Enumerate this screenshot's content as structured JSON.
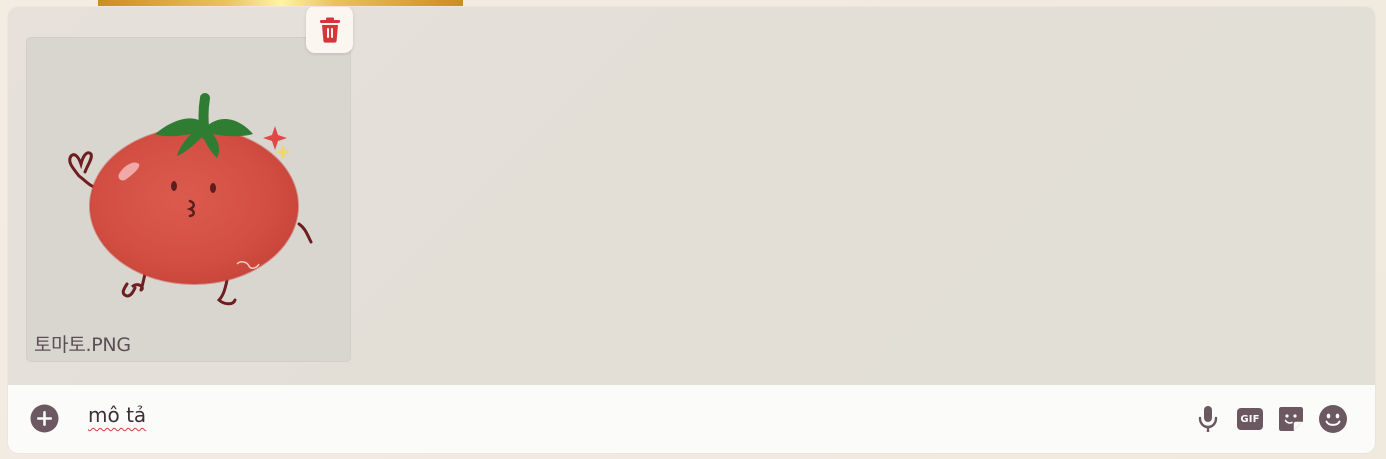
{
  "attachments": [
    {
      "filename": "토마토.PNG",
      "preview_icon": "tomato-character-image"
    }
  ],
  "delete_icon": "trash-icon",
  "input": {
    "value": "mô tả"
  },
  "toolbar": {
    "icons": [
      "plus-icon",
      "microphone-icon",
      "gif-icon",
      "sticker-icon",
      "emoji-icon"
    ],
    "gif_label": "GIF"
  },
  "colors": {
    "accent_red": "#d6363a",
    "icon_color": "#6b5861",
    "composer_bg": "#e3dfd7",
    "input_bg": "#fbfbfa"
  }
}
